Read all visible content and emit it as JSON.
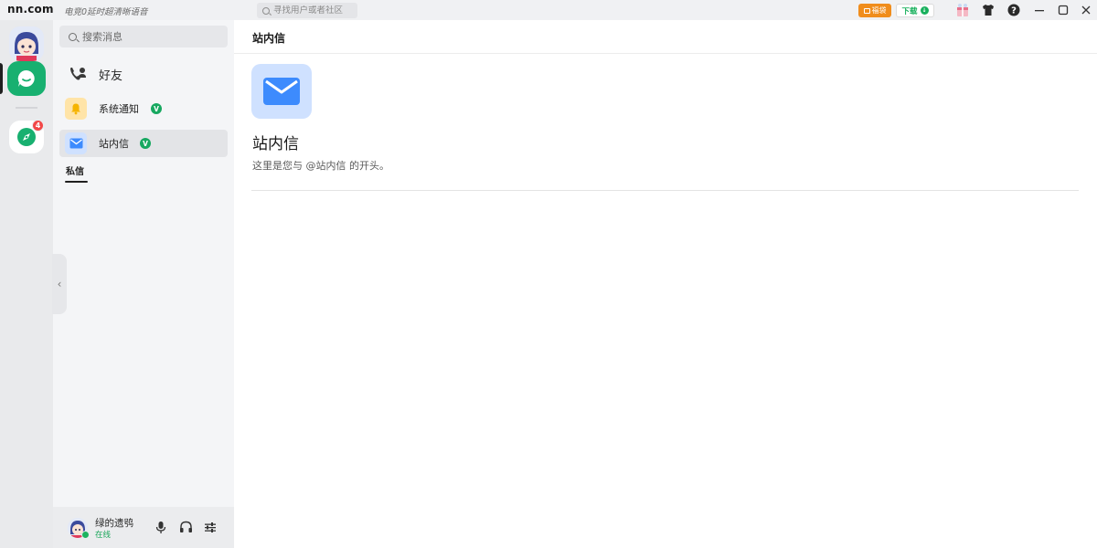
{
  "titlebar": {
    "brand": "nn.com",
    "slogan": "电竞0延时超清晰语音",
    "search_placeholder": "寻找用户或者社区",
    "orange_button_label": "福袋",
    "download_label": "下载"
  },
  "rail": {
    "discover_badge": "4"
  },
  "sidebar": {
    "search_placeholder": "搜索消息",
    "friends_label": "好友",
    "items": [
      {
        "label": "系统通知",
        "verified": "V"
      },
      {
        "label": "站内信",
        "verified": "V"
      }
    ],
    "section_tab": "私信"
  },
  "user": {
    "name": "绿的遗鸮",
    "status": "在线"
  },
  "main": {
    "title": "站内信",
    "hero_name": "站内信",
    "hero_desc": "这里是您与 @站内信 的开头。"
  },
  "colors": {
    "accent_green": "#18b070",
    "mail_blue": "#3d8bfd",
    "bell_yellow": "#f5b400",
    "badge_red": "#f24848"
  }
}
